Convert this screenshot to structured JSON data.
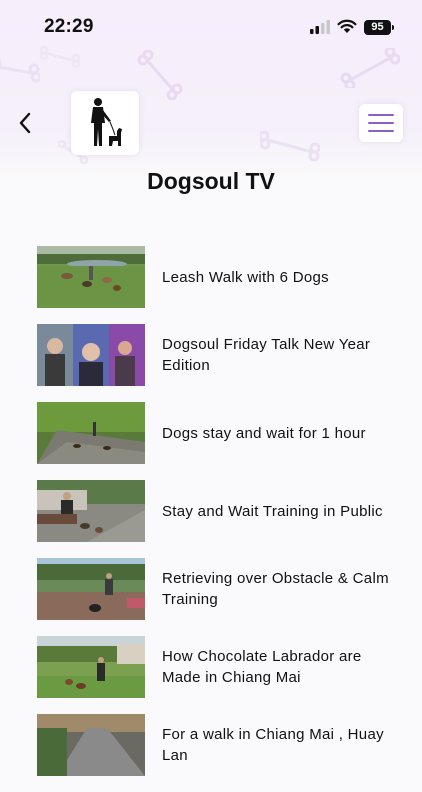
{
  "status_bar": {
    "time": "22:29",
    "battery": "95"
  },
  "header": {
    "back_icon": "chevron-left-icon",
    "logo_icon": "dog-trainer-logo",
    "menu_icon": "hamburger-menu-icon",
    "accent_color": "#8d5fc6"
  },
  "page": {
    "title": "Dogsoul TV"
  },
  "videos": [
    {
      "title": "Leash Walk with 6 Dogs"
    },
    {
      "title": "Dogsoul Friday Talk New Year Edition"
    },
    {
      "title": "Dogs stay and wait for 1 hour"
    },
    {
      "title": "Stay and Wait Training in Public"
    },
    {
      "title": "Retrieving over Obstacle & Calm Training"
    },
    {
      "title": "How Chocolate Labrador are Made in Chiang  Mai"
    },
    {
      "title": "For a walk in Chiang Mai , Huay Lan"
    }
  ]
}
